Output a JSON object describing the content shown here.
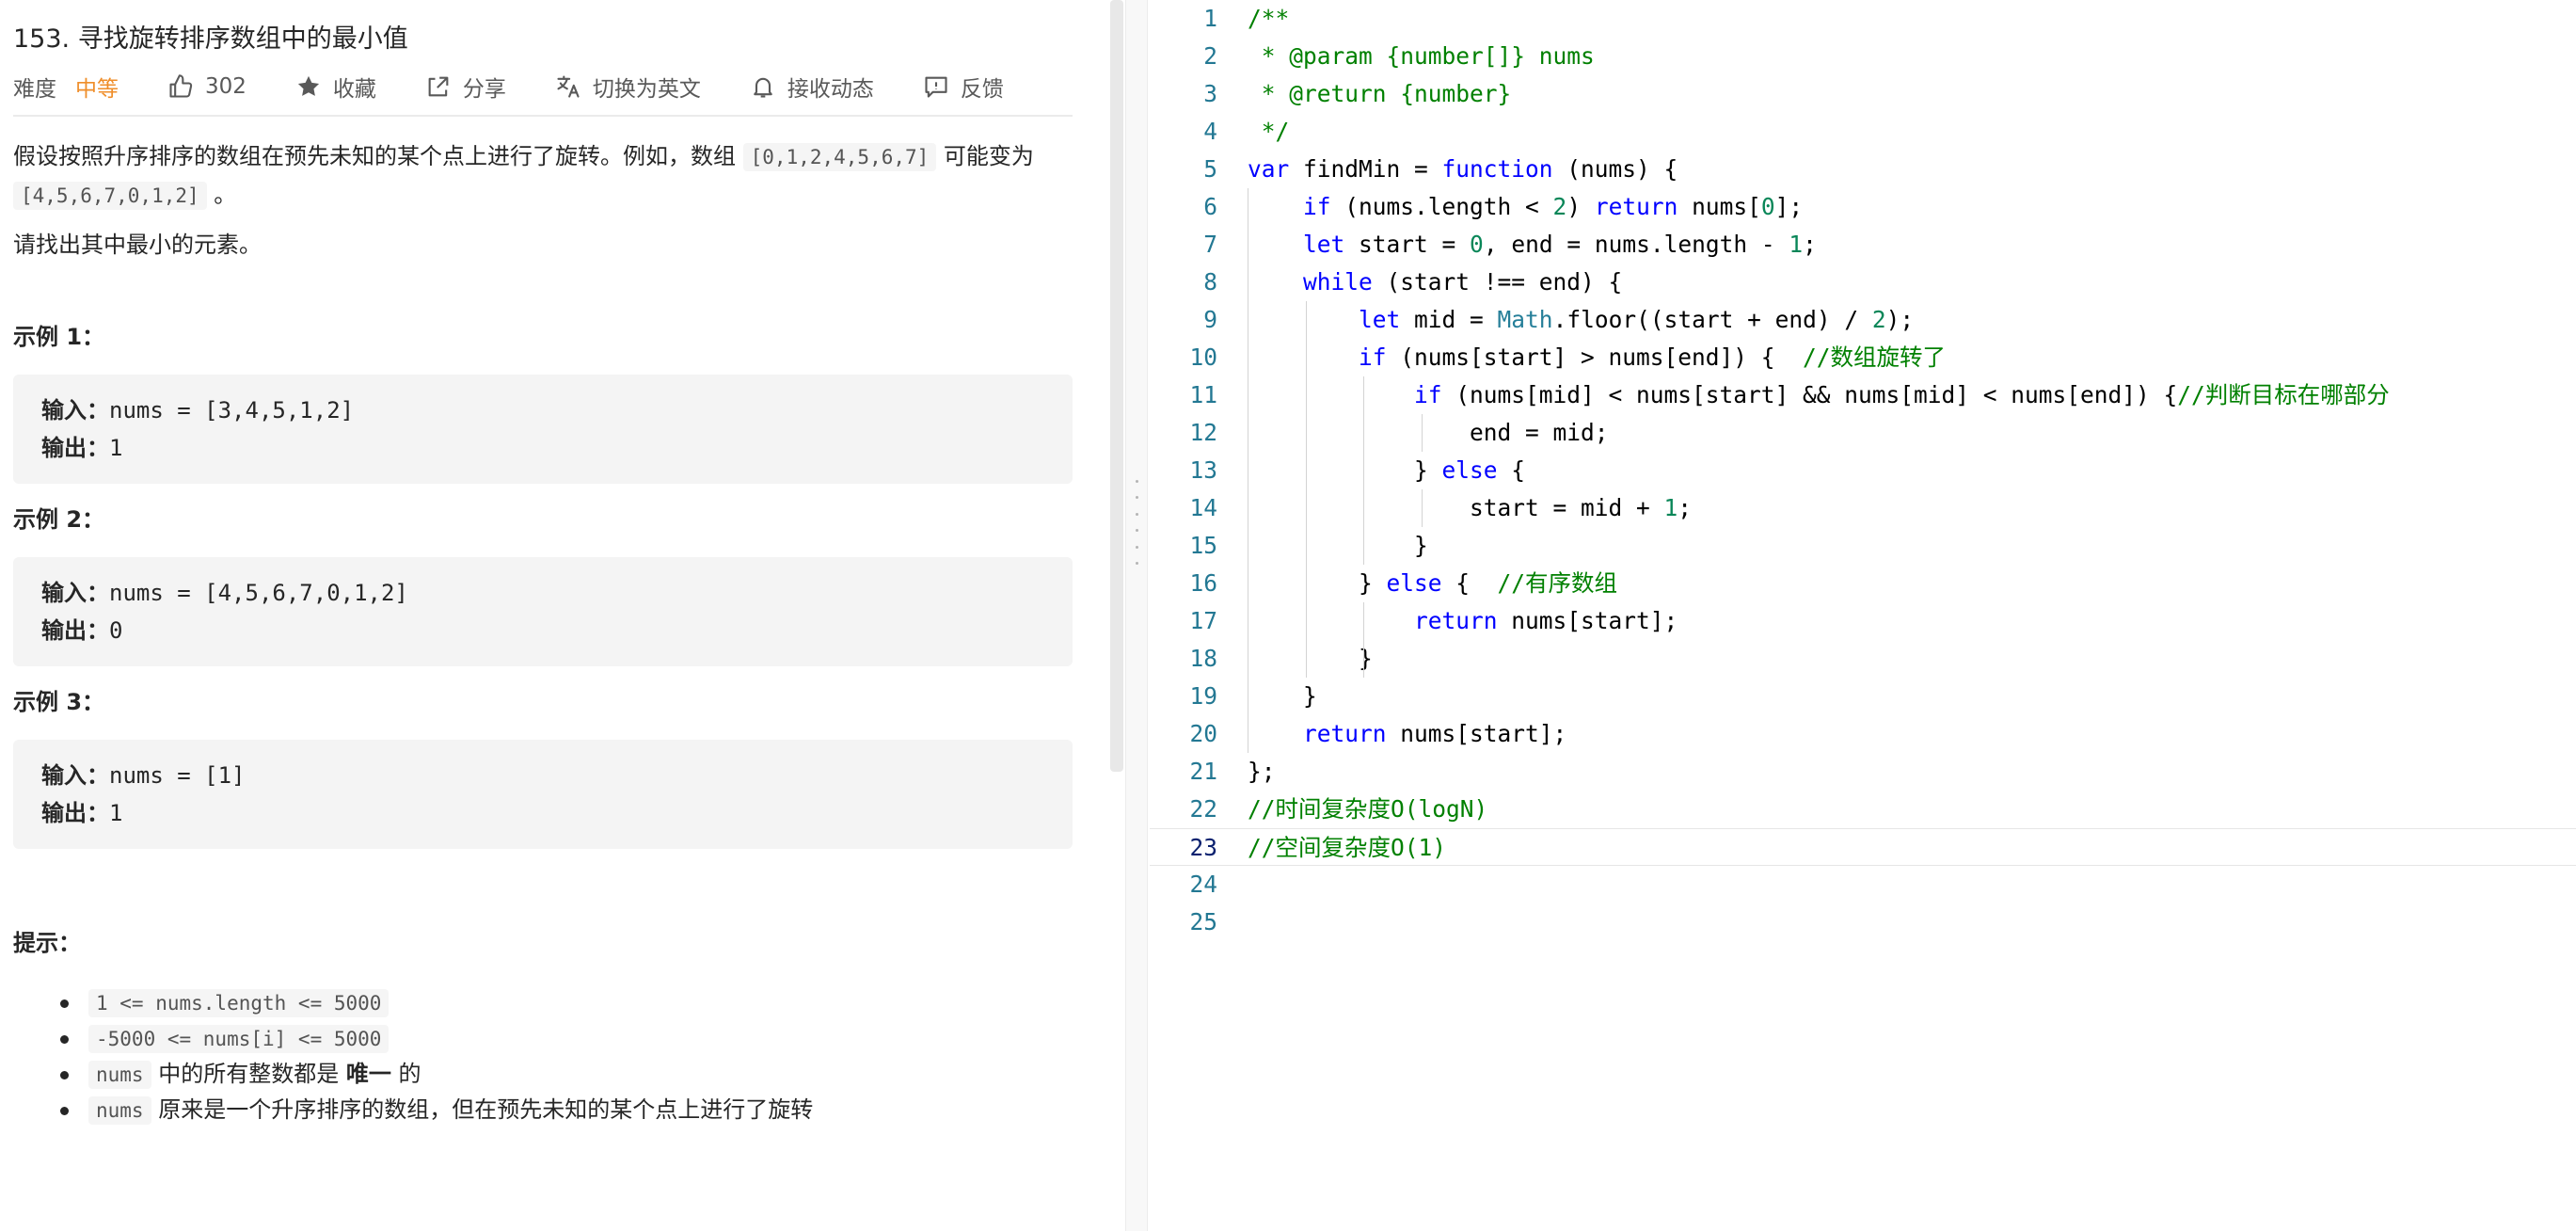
{
  "problem": {
    "title": "153. 寻找旋转排序数组中的最小值",
    "difficulty_label": "难度",
    "difficulty_value": "中等",
    "likes": "302",
    "favorite_label": "收藏",
    "share_label": "分享",
    "switch_lang_label": "切换为英文",
    "subscribe_label": "接收动态",
    "feedback_label": "反馈",
    "desc_part1": "假设按照升序排序的数组在预先未知的某个点上进行了旋转。例如，数组 ",
    "desc_code1": "[0,1,2,4,5,6,7]",
    "desc_part2": " 可能变为 ",
    "desc_code2": "[4,5,6,7,0,1,2]",
    "desc_part3": " 。",
    "desc_line2": "请找出其中最小的元素。",
    "examples": [
      {
        "title": "示例 1：",
        "input_label": "输入：",
        "input": "nums = [3,4,5,1,2]",
        "output_label": "输出：",
        "output": "1"
      },
      {
        "title": "示例 2：",
        "input_label": "输入：",
        "input": "nums = [4,5,6,7,0,1,2]",
        "output_label": "输出：",
        "output": "0"
      },
      {
        "title": "示例 3：",
        "input_label": "输入：",
        "input": "nums = [1]",
        "output_label": "输出：",
        "output": "1"
      }
    ],
    "hints_title": "提示：",
    "hints": [
      {
        "code": "1 <= nums.length <= 5000",
        "text": ""
      },
      {
        "code": "-5000 <= nums[i] <= 5000",
        "text": ""
      },
      {
        "code": "nums",
        "text": " 中的所有整数都是 ",
        "strong": "唯一",
        "tail": " 的"
      },
      {
        "code": "nums",
        "text": " 原来是一个升序排序的数组，但在预先未知的某个点上进行了旋转"
      }
    ]
  },
  "editor": {
    "current_line": 23,
    "lines": [
      {
        "n": "1",
        "tokens": [
          [
            "c",
            "/**"
          ]
        ]
      },
      {
        "n": "2",
        "tokens": [
          [
            "c",
            " * @param {number[]} nums"
          ]
        ]
      },
      {
        "n": "3",
        "tokens": [
          [
            "c",
            " * @return {number}"
          ]
        ]
      },
      {
        "n": "4",
        "tokens": [
          [
            "c",
            " */"
          ]
        ]
      },
      {
        "n": "5",
        "tokens": [
          [
            "k",
            "var"
          ],
          [
            "t",
            " findMin = "
          ],
          [
            "k",
            "function"
          ],
          [
            "t",
            " (nums) {"
          ]
        ]
      },
      {
        "n": "6",
        "tokens": [
          [
            "t",
            "    "
          ],
          [
            "k",
            "if"
          ],
          [
            "t",
            " (nums.length < "
          ],
          [
            "n",
            "2"
          ],
          [
            "t",
            ") "
          ],
          [
            "k",
            "return"
          ],
          [
            "t",
            " nums["
          ],
          [
            "n",
            "0"
          ],
          [
            "t",
            "];"
          ]
        ]
      },
      {
        "n": "7",
        "tokens": [
          [
            "t",
            "    "
          ],
          [
            "k",
            "let"
          ],
          [
            "t",
            " start = "
          ],
          [
            "n",
            "0"
          ],
          [
            "t",
            ", end = nums.length - "
          ],
          [
            "n",
            "1"
          ],
          [
            "t",
            ";"
          ]
        ]
      },
      {
        "n": "8",
        "tokens": [
          [
            "t",
            "    "
          ],
          [
            "k",
            "while"
          ],
          [
            "t",
            " (start !== end) {"
          ]
        ]
      },
      {
        "n": "9",
        "tokens": [
          [
            "t",
            "        "
          ],
          [
            "k",
            "let"
          ],
          [
            "t",
            " mid = "
          ],
          [
            "y",
            "Math"
          ],
          [
            "t",
            ".floor((start + end) / "
          ],
          [
            "n",
            "2"
          ],
          [
            "t",
            ");"
          ]
        ]
      },
      {
        "n": "10",
        "tokens": [
          [
            "t",
            "        "
          ],
          [
            "k",
            "if"
          ],
          [
            "t",
            " (nums[start] > nums[end]) {  "
          ],
          [
            "c",
            "//数组旋转了"
          ]
        ]
      },
      {
        "n": "11",
        "tokens": [
          [
            "t",
            "            "
          ],
          [
            "k",
            "if"
          ],
          [
            "t",
            " (nums[mid] < nums[start] && nums[mid] < nums[end]) {"
          ],
          [
            "c",
            "//判断目标在哪部分"
          ]
        ]
      },
      {
        "n": "12",
        "tokens": [
          [
            "t",
            "                end = mid;"
          ]
        ]
      },
      {
        "n": "13",
        "tokens": [
          [
            "t",
            "            } "
          ],
          [
            "k",
            "else"
          ],
          [
            "t",
            " {"
          ]
        ]
      },
      {
        "n": "14",
        "tokens": [
          [
            "t",
            "                start = mid + "
          ],
          [
            "n",
            "1"
          ],
          [
            "t",
            ";"
          ]
        ]
      },
      {
        "n": "15",
        "tokens": [
          [
            "t",
            "            }"
          ]
        ]
      },
      {
        "n": "16",
        "tokens": [
          [
            "t",
            "        } "
          ],
          [
            "k",
            "else"
          ],
          [
            "t",
            " {  "
          ],
          [
            "c",
            "//有序数组"
          ]
        ]
      },
      {
        "n": "17",
        "tokens": [
          [
            "t",
            "            "
          ],
          [
            "k",
            "return"
          ],
          [
            "t",
            " nums[start];"
          ]
        ]
      },
      {
        "n": "18",
        "tokens": [
          [
            "t",
            "        }"
          ]
        ]
      },
      {
        "n": "19",
        "tokens": [
          [
            "t",
            "    }"
          ]
        ]
      },
      {
        "n": "20",
        "tokens": [
          [
            "t",
            "    "
          ],
          [
            "k",
            "return"
          ],
          [
            "t",
            " nums[start];"
          ]
        ]
      },
      {
        "n": "21",
        "tokens": [
          [
            "t",
            "};"
          ]
        ]
      },
      {
        "n": "22",
        "tokens": [
          [
            "c",
            "//时间复杂度O(logN)"
          ]
        ]
      },
      {
        "n": "23",
        "tokens": [
          [
            "c",
            "//空间复杂度O(1)"
          ]
        ]
      },
      {
        "n": "24",
        "tokens": []
      },
      {
        "n": "25",
        "tokens": []
      }
    ]
  },
  "colors": {
    "difficulty_medium": "#ef8e2a",
    "code_keyword": "#0000ff",
    "code_comment": "#008000",
    "code_number": "#098658",
    "line_number": "#237893"
  },
  "icons": [
    "thumbs-up-icon",
    "star-icon",
    "share-icon",
    "translate-icon",
    "bell-icon",
    "feedback-icon"
  ]
}
